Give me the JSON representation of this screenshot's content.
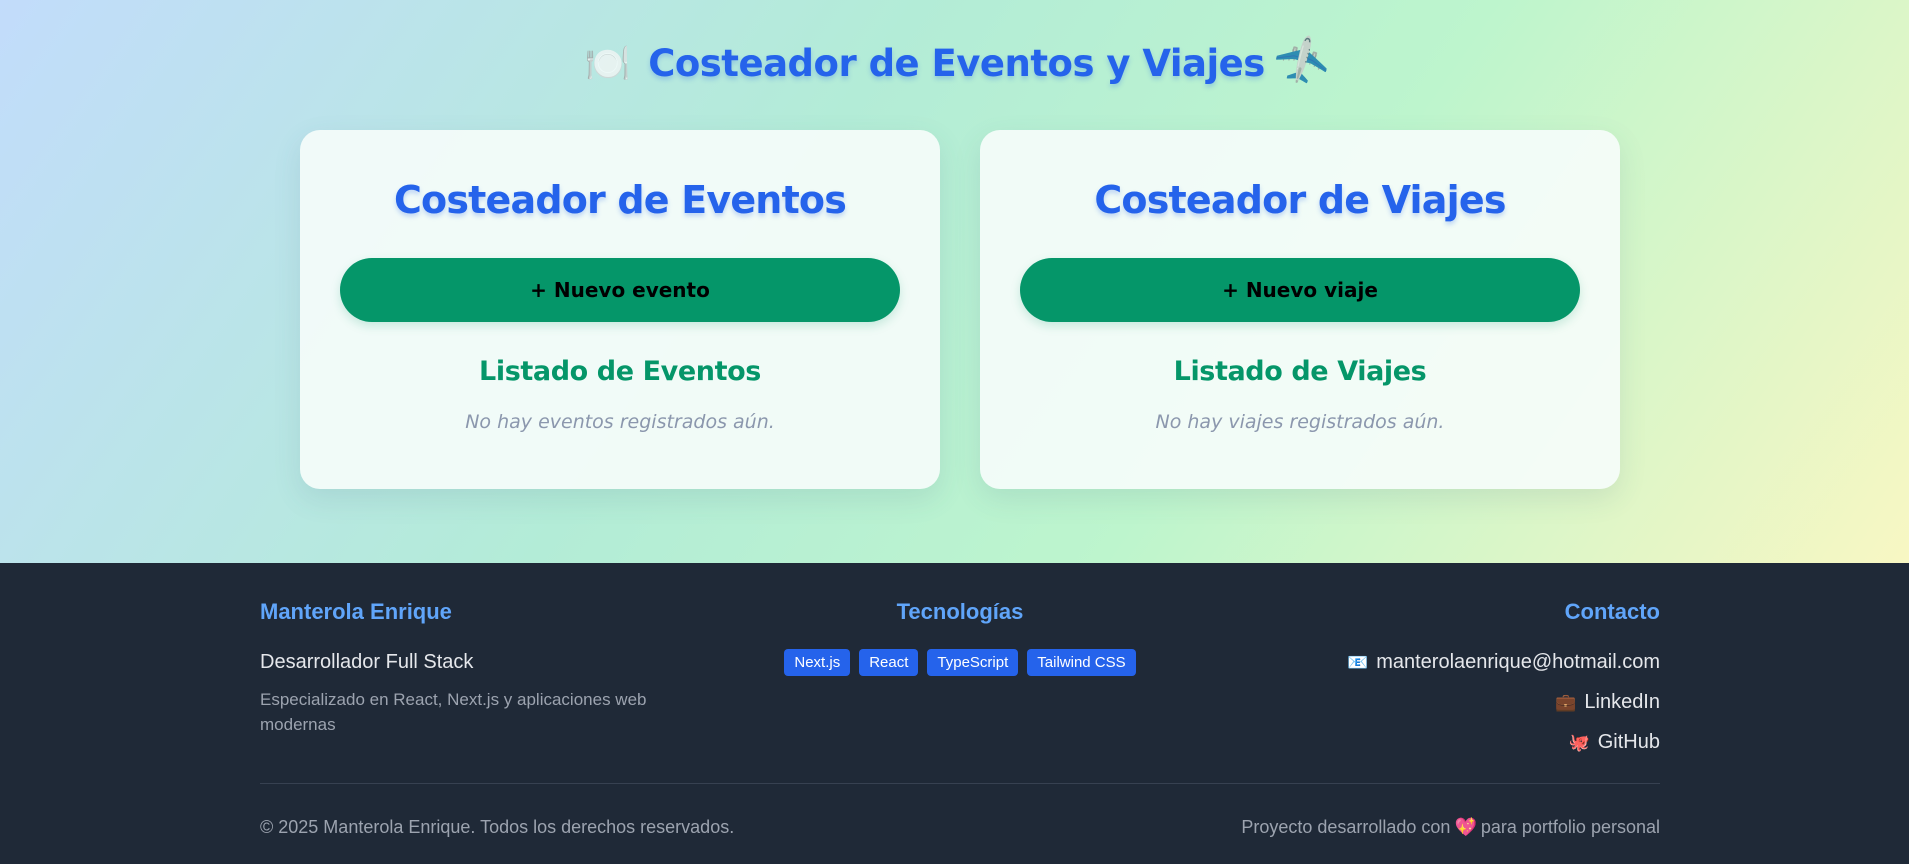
{
  "page": {
    "title_icon_left": "🍽️",
    "title": "Costeador de Eventos y Viajes",
    "title_icon_right": "✈️"
  },
  "events": {
    "title": "Costeador de Eventos",
    "new_button": "+ Nuevo evento",
    "list_title": "Listado de Eventos",
    "empty_message": "No hay eventos registrados aún."
  },
  "trips": {
    "title": "Costeador de Viajes",
    "new_button": "+ Nuevo viaje",
    "list_title": "Listado de Viajes",
    "empty_message": "No hay viajes registrados aún."
  },
  "footer": {
    "author": {
      "name": "Manterola Enrique",
      "role": "Desarrollador Full Stack",
      "description": "Especializado en React, Next.js y aplicaciones web modernas"
    },
    "tech": {
      "heading": "Tecnologías",
      "tags": [
        "Next.js",
        "React",
        "TypeScript",
        "Tailwind CSS"
      ]
    },
    "contact": {
      "heading": "Contacto",
      "email_icon": "📧",
      "email": "manterolaenrique@hotmail.com",
      "linkedin_icon": "💼",
      "linkedin": "LinkedIn",
      "github_icon": "🐙",
      "github": "GitHub"
    },
    "copyright": "© 2025 Manterola Enrique. Todos los derechos reservados.",
    "made_with_prefix": "Proyecto desarrollado con",
    "heart": "💖",
    "made_with_suffix": "para portfolio personal"
  },
  "colors": {
    "accent_blue": "#2563eb",
    "accent_green": "#059669",
    "footer_bg": "#1f2937"
  }
}
